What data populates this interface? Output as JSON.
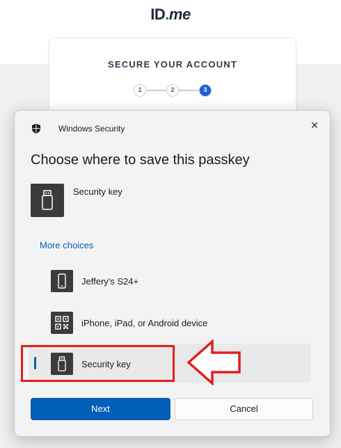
{
  "site": {
    "logo_prefix": "ID",
    "logo_dot": ".",
    "logo_suffix": "me",
    "card_title": "SECURE YOUR ACCOUNT",
    "steps": [
      "1",
      "2",
      "3"
    ],
    "active_step": 3
  },
  "dialog": {
    "app_title": "Windows Security",
    "close_symbol": "✕",
    "heading": "Choose where to save this passkey",
    "primary_option": {
      "label": "Security key",
      "icon": "usb-key-icon"
    },
    "more_choices": "More choices",
    "options": [
      {
        "label": "Jeffery's S24+",
        "icon": "phone-icon",
        "selected": false
      },
      {
        "label": "iPhone, iPad, or Android device",
        "icon": "qr-code-icon",
        "selected": false
      },
      {
        "label": "Security key",
        "icon": "usb-key-icon",
        "selected": true
      }
    ],
    "next_label": "Next",
    "cancel_label": "Cancel"
  },
  "colors": {
    "accent": "#005fb8",
    "annotation": "#e0201c",
    "tile": "#3b3b3b",
    "step_active": "#1e5cd6"
  }
}
